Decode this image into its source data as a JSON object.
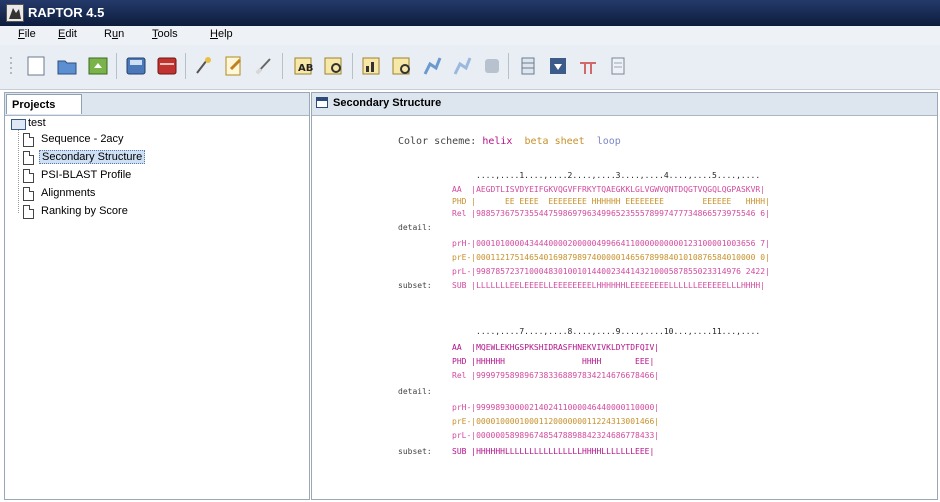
{
  "window": {
    "title": "RAPTOR 4.5"
  },
  "menu": [
    {
      "label": "File",
      "ul": "F"
    },
    {
      "label": "Edit",
      "ul": "E"
    },
    {
      "label": "Run",
      "ul": "u"
    },
    {
      "label": "Tools",
      "ul": "T"
    },
    {
      "label": "Help",
      "ul": "H"
    }
  ],
  "toolbar": {
    "icons": [
      "new-file-icon",
      "open-folder-icon",
      "import-icon",
      "save-icon",
      "database-icon",
      "wizard-icon",
      "edit-document-icon",
      "eraser-icon",
      "ab-tool-icon",
      "ab-search-icon",
      "bar-chart-icon",
      "bar-chart-search-icon",
      "run-icon",
      "run-step-icon",
      "stop-icon",
      "stack-icon",
      "download-icon",
      "tree-icon",
      "report-icon"
    ]
  },
  "colors": {
    "helix": "#b4128a",
    "beta": "#c8902a",
    "loop": "#7d86c8",
    "titlebar": "#1a2d55"
  },
  "projects": {
    "tab_label": "Projects",
    "root": "test",
    "items": [
      "Sequence - 2acy",
      "Secondary Structure",
      "PSI-BLAST Profile",
      "Alignments",
      "Ranking by Score"
    ],
    "selected_index": 1
  },
  "content": {
    "panel_title": "Secondary Structure",
    "color_scheme": {
      "label": "Color scheme:",
      "helix": "helix",
      "beta": "beta sheet",
      "loop": "loop"
    },
    "block1": {
      "ruler": "....,....1....,....2....,....3....,....4....,....5....,....",
      "aa": "AA  |AEGDTLISVDYEIFGKVQGVFFRKYTQAEGKKLGLVGWVQNTDQGTVQGQLQGPASKVR|",
      "phd": "PHD |      EE EEEE  EEEEEEEE HHHHHH EEEEEEEE        EEEEEE   HHHH|",
      "rel": "Rel |9885736757355447598697963499652355578997477734866573975546 6|",
      "detail": "detail:",
      "prH": "prH-|0001010000434440000200000499664110000000000123100001003656 7|",
      "prE": "prE-|0001121751465401698798974000001465678998401010876584010000 0|",
      "prL": "prL-|9987857237100048301001014400234414321000587855023314976 2422|",
      "subset_label": "subset:",
      "sub": "SUB |LLLLLLLEELEEEELLEEEEEEEELHHHHHHLEEEEEEEELLLLLLEEEEEELLLHHHH|"
    },
    "block2": {
      "ruler": "....,....7....,....8....,....9....,....10...,....11...,....",
      "aa": "AA  |MQEWLEKHGSPKSHIDRASFHNEKVIVKLDYTDFQIV|",
      "phd": "PHD |HHHHHH                HHHH       EEE|",
      "rel": "Rel |9999795898967383368897834214676678466|",
      "detail": "detail:",
      "prH": "prH-|9999893000021402411000046440000110000|",
      "prE": "prE-|0000100001000112000000011224313001466|",
      "prL": "prL-|0000005898967485478898842324686778433|",
      "subset_label": "subset:",
      "sub": "SUB |HHHHHHLLLLLLLLLLLLLLLLHHHHLLLLLLLEEE|"
    }
  }
}
